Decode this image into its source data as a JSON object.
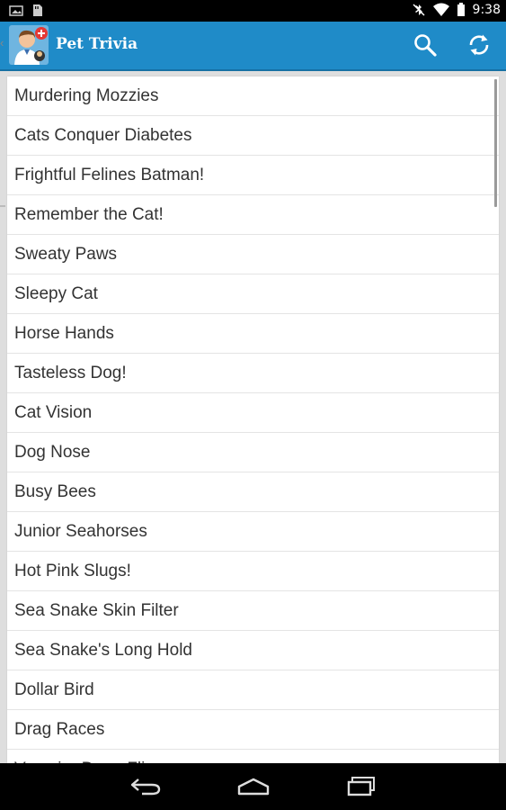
{
  "status_bar": {
    "time": "9:38",
    "icons": [
      "notification-photo-icon",
      "notification-sd-icon",
      "mute-icon",
      "wifi-icon",
      "battery-icon"
    ]
  },
  "action_bar": {
    "title": "Pet Trivia",
    "app_icon": "vet-avatar-icon",
    "actions": [
      "search-icon",
      "refresh-icon"
    ],
    "color": "#1f8bc8"
  },
  "list": {
    "items": [
      "Murdering Mozzies",
      "Cats Conquer Diabetes",
      "Frightful Felines Batman!",
      "Remember the Cat!",
      "Sweaty Paws",
      "Sleepy Cat",
      "Horse Hands",
      "Tasteless Dog!",
      "Cat Vision",
      "Dog Nose",
      "Busy Bees",
      "Junior Seahorses",
      "Hot Pink Slugs!",
      "Sea Snake Skin Filter",
      "Sea Snake's Long Hold",
      "Dollar Bird",
      "Drag Races",
      "Vampire Dung Flies"
    ]
  },
  "nav_bar": {
    "buttons": [
      "back-icon",
      "home-icon",
      "recent-apps-icon"
    ]
  }
}
